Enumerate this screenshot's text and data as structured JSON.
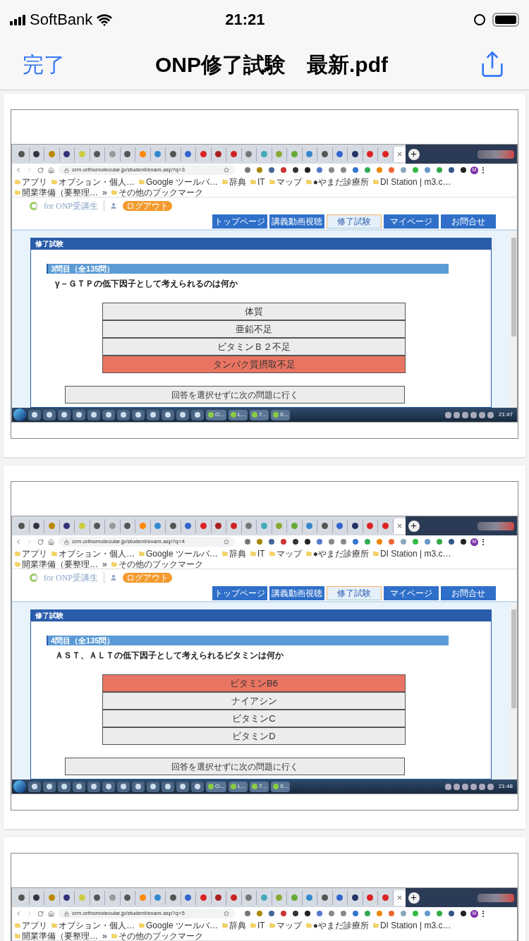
{
  "status_bar": {
    "carrier": "SoftBank",
    "time": "21:21"
  },
  "nav_bar": {
    "done": "完了",
    "title": "ONP修了試験　最新.pdf"
  },
  "pages": [
    {
      "url": "crm.orthomolecular.jp/student/exam.asp?q=3",
      "avatar": "M",
      "bookmarks": [
        "アプリ",
        "オプション・個人…",
        "Google ツールバ…",
        "辞典",
        "IT",
        "マップ",
        "●やまだ診療所",
        "DI Station | m3.c…",
        "開業準備（要整理…",
        "»",
        "その他のブックマーク"
      ],
      "site": {
        "logo": "for ONP受講生",
        "logout": "ログアウト"
      },
      "nav": [
        {
          "label": "トップページ",
          "selected": false
        },
        {
          "label": "講義動画視聴",
          "selected": false
        },
        {
          "label": "修了試験",
          "selected": true
        },
        {
          "label": "マイページ",
          "selected": false
        },
        {
          "label": "お問合せ",
          "selected": false
        }
      ],
      "panel_title": "修了試験",
      "question_header": "3問目（全135問）",
      "question": "γ－ＧＴＰの低下因子として考えられるのは何か",
      "options": [
        {
          "label": "体質",
          "selected": false
        },
        {
          "label": "亜鉛不足",
          "selected": false
        },
        {
          "label": "ビタミンＢ２不足",
          "selected": false
        },
        {
          "label": "タンパク質摂取不足",
          "selected": true
        }
      ],
      "skip": "回答を選択せずに次の問題に行く",
      "taskbar": {
        "labels": [
          "O...",
          "L...",
          "7...",
          "0..."
        ],
        "time": "21:47"
      }
    },
    {
      "url": "crm.orthomolecular.jp/student/exam.asp?q=4",
      "avatar": "M",
      "bookmarks": [
        "アプリ",
        "オプション・個人…",
        "Google ツールバ…",
        "辞典",
        "IT",
        "マップ",
        "●やまだ診療所",
        "DI Station | m3.c…",
        "開業準備（要整理…",
        "»",
        "その他のブックマーク"
      ],
      "site": {
        "logo": "for ONP受講生",
        "logout": "ログアウト"
      },
      "nav": [
        {
          "label": "トップページ",
          "selected": false
        },
        {
          "label": "講義動画視聴",
          "selected": false
        },
        {
          "label": "修了試験",
          "selected": true
        },
        {
          "label": "マイページ",
          "selected": false
        },
        {
          "label": "お問合せ",
          "selected": false
        }
      ],
      "panel_title": "修了試験",
      "question_header": "4問目（全135問）",
      "question": "ＡＳＴ、ＡＬＴの低下因子として考えられるビタミンは何か",
      "options": [
        {
          "label": "ビタミンB6",
          "selected": true
        },
        {
          "label": "ナイアシン",
          "selected": false
        },
        {
          "label": "ビタミンC",
          "selected": false
        },
        {
          "label": "ビタミンD",
          "selected": false
        }
      ],
      "skip": "回答を選択せずに次の問題に行く",
      "taskbar": {
        "labels": [
          "O...",
          "L...",
          "7...",
          "0..."
        ],
        "time": "21:48"
      }
    },
    {
      "url": "crm.orthomolecular.jp/student/exam.asp?q=5",
      "avatar": "M",
      "bookmarks": [
        "アプリ",
        "オプション・個人…",
        "Google ツールバ…",
        "辞典",
        "IT",
        "マップ",
        "●やまだ診療所",
        "DI Station | m3.c…",
        "開業準備（要整理…",
        "»",
        "その他のブックマーク"
      ]
    }
  ]
}
